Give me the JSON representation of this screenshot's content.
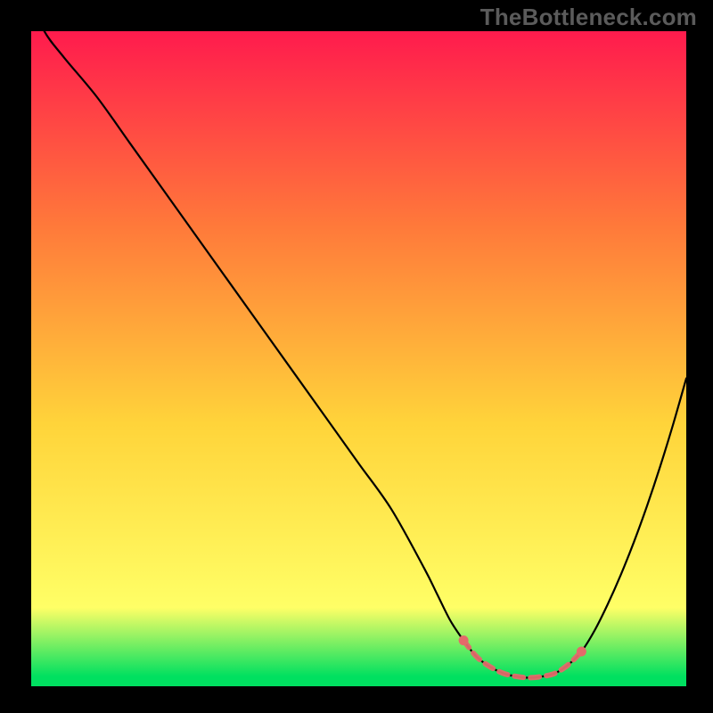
{
  "watermark": {
    "text": "TheBottleneck.com"
  },
  "colors": {
    "background": "#000000",
    "grad_top": "#ff1b4d",
    "grad_mid1": "#ff7a3a",
    "grad_mid2": "#ffd43a",
    "grad_mid3": "#ffff66",
    "grad_bottom": "#00e060",
    "curve": "#000000",
    "marker": "#e46a6a"
  },
  "chart_data": {
    "type": "line",
    "title": "",
    "xlabel": "",
    "ylabel": "",
    "xlim": [
      0,
      100
    ],
    "ylim": [
      0,
      100
    ],
    "series": [
      {
        "name": "bottleneck-curve",
        "x": [
          0,
          2,
          5,
          10,
          15,
          20,
          25,
          30,
          35,
          40,
          45,
          50,
          55,
          60,
          62,
          64,
          66,
          68,
          70,
          72,
          74,
          76,
          78,
          80,
          82,
          84,
          86,
          88,
          90,
          92,
          94,
          96,
          98,
          100
        ],
        "y": [
          105,
          100,
          96,
          90,
          83,
          76,
          69,
          62,
          55,
          48,
          41,
          34,
          27,
          18,
          14,
          10,
          7,
          4.5,
          3,
          2,
          1.5,
          1.3,
          1.5,
          2,
          3.3,
          5.3,
          8.5,
          12.5,
          17,
          22,
          27.5,
          33.5,
          40,
          47
        ]
      }
    ],
    "markers": {
      "name": "optimal-range",
      "x": [
        66,
        68,
        70,
        72,
        74,
        76,
        78,
        80,
        82,
        84
      ],
      "y": [
        7,
        4.5,
        3,
        2,
        1.5,
        1.3,
        1.5,
        2,
        3.3,
        5.3
      ]
    }
  }
}
